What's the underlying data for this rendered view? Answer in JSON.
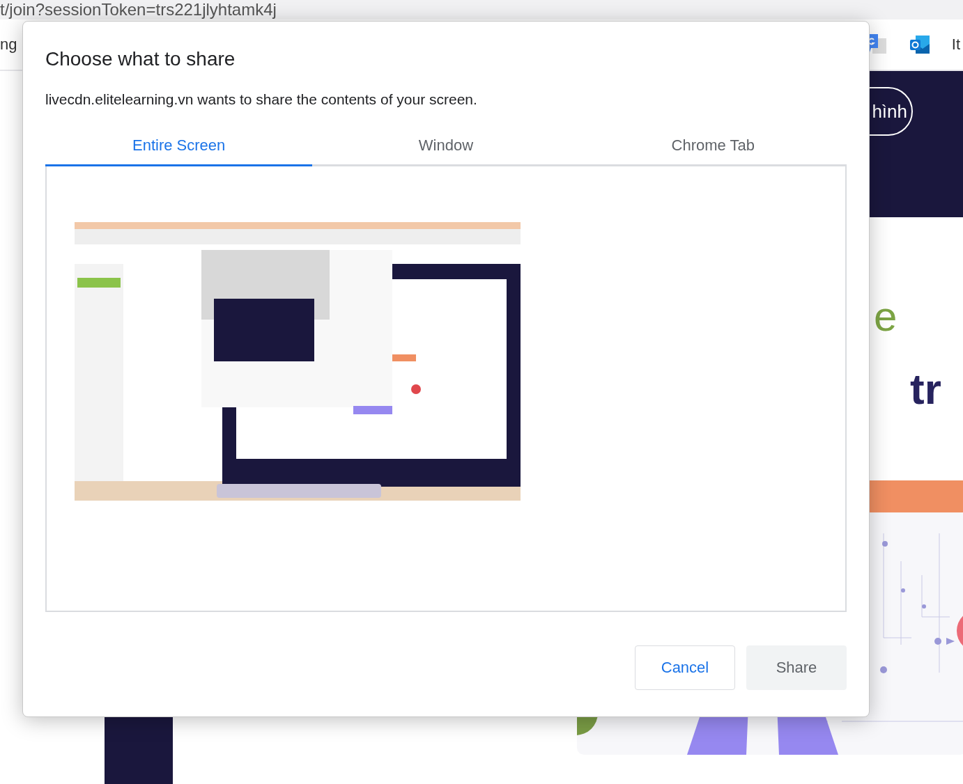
{
  "browser": {
    "address_text": "t/join?sessionToken=trs221jlyhtamk4j",
    "toolbar_text": "ng",
    "bookmark_text": "It"
  },
  "page": {
    "pill_button": "hình",
    "heading_line_1": "e",
    "heading_line_2": "tr"
  },
  "dialog": {
    "title": "Choose what to share",
    "message": "livecdn.elitelearning.vn wants to share the contents of your screen.",
    "tabs": [
      {
        "label": "Entire Screen",
        "selected": true
      },
      {
        "label": "Window",
        "selected": false
      },
      {
        "label": "Chrome Tab",
        "selected": false
      }
    ],
    "buttons": [
      {
        "label": "Cancel",
        "disabled": false
      },
      {
        "label": "Share",
        "disabled": true
      }
    ]
  }
}
